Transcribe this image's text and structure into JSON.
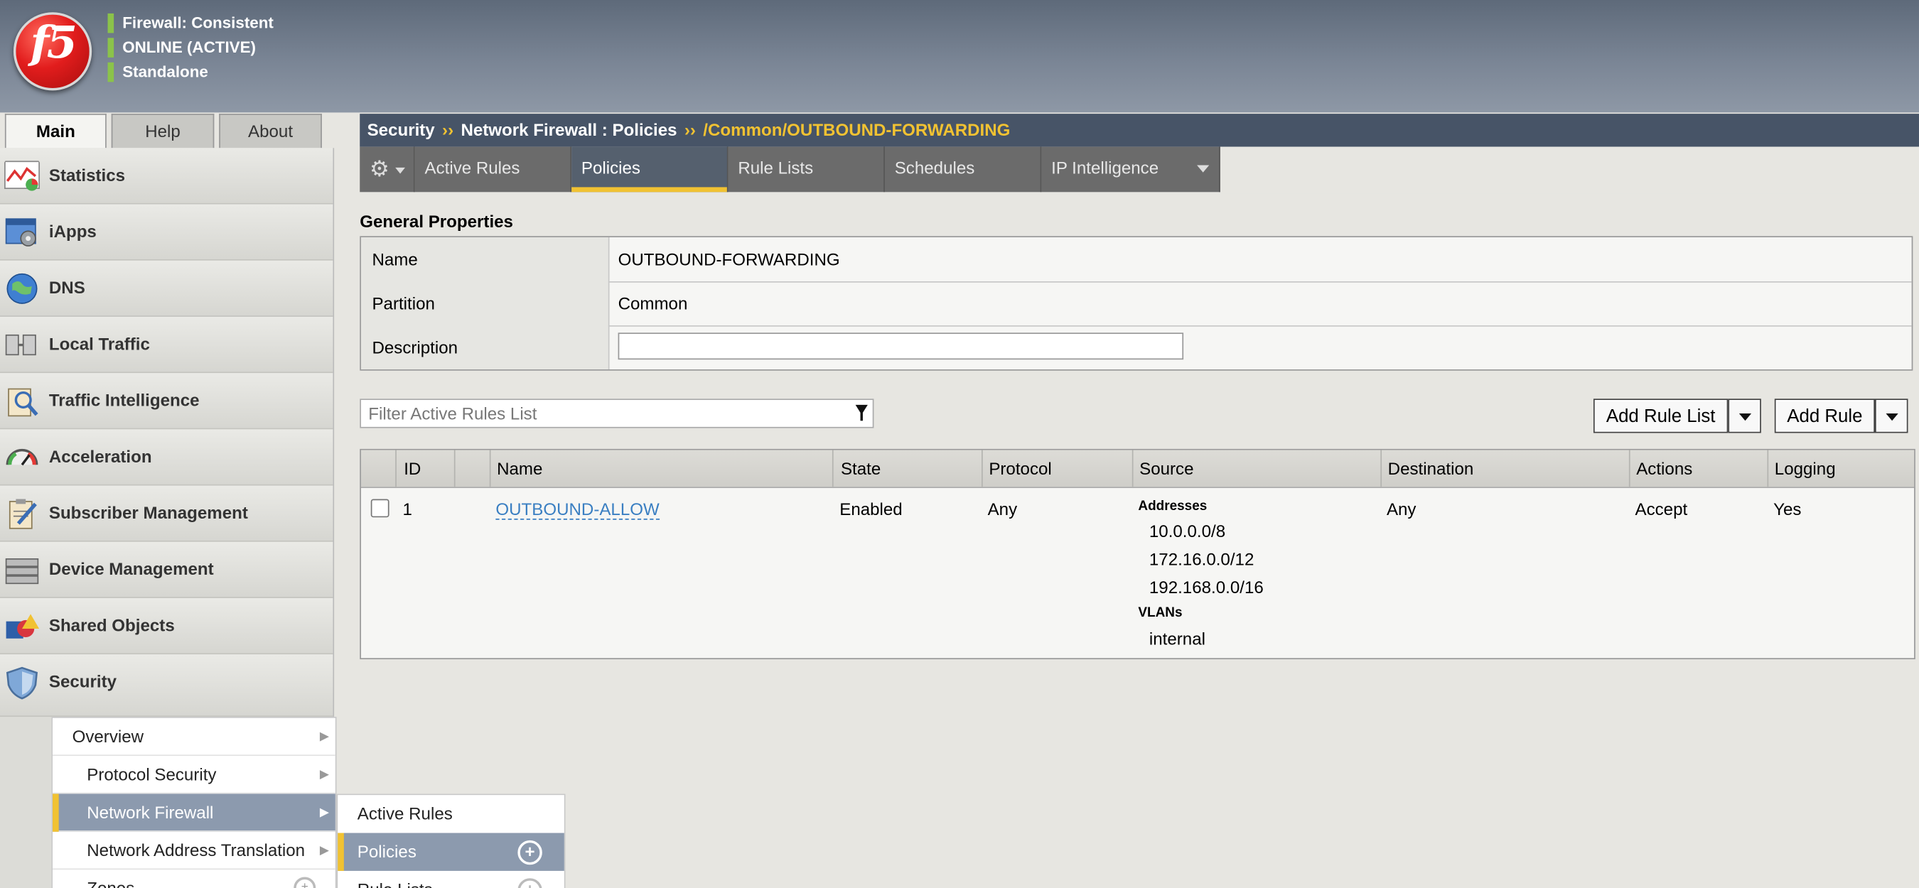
{
  "header": {
    "logo_text": "f5",
    "status": [
      "Firewall: Consistent",
      "ONLINE (ACTIVE)",
      "Standalone"
    ]
  },
  "left_tabs": [
    "Main",
    "Help",
    "About"
  ],
  "nav": [
    {
      "label": "Statistics",
      "icon": "chart-icon"
    },
    {
      "label": "iApps",
      "icon": "iapps-icon"
    },
    {
      "label": "DNS",
      "icon": "globe-icon"
    },
    {
      "label": "Local Traffic",
      "icon": "local-traffic-icon"
    },
    {
      "label": "Traffic Intelligence",
      "icon": "traffic-intelligence-icon"
    },
    {
      "label": "Acceleration",
      "icon": "speedometer-icon"
    },
    {
      "label": "Subscriber Management",
      "icon": "clipboard-icon"
    },
    {
      "label": "Device Management",
      "icon": "server-icon"
    },
    {
      "label": "Shared Objects",
      "icon": "shapes-icon"
    },
    {
      "label": "Security",
      "icon": "shield-icon"
    }
  ],
  "security_submenu": [
    "Overview",
    "Protocol Security",
    "Network Firewall",
    "Network Address Translation",
    "Zones"
  ],
  "flyout": [
    "Active Rules",
    "Policies",
    "Rule Lists"
  ],
  "breadcrumb": {
    "a": "Security",
    "b": "Network Firewall : Policies",
    "current": "/Common/OUTBOUND-FORWARDING",
    "sep": "››"
  },
  "tabs": [
    "Active Rules",
    "Policies",
    "Rule Lists",
    "Schedules",
    "IP Intelligence"
  ],
  "general": {
    "title": "General Properties",
    "rows": [
      {
        "k": "Name",
        "v": "OUTBOUND-FORWARDING"
      },
      {
        "k": "Partition",
        "v": "Common"
      },
      {
        "k": "Description",
        "v": ""
      }
    ]
  },
  "filter": {
    "placeholder": "Filter Active Rules List"
  },
  "buttons": {
    "add_rule_list": "Add Rule List",
    "add_rule": "Add Rule"
  },
  "table": {
    "headers": [
      "ID",
      "Name",
      "State",
      "Protocol",
      "Source",
      "Destination",
      "Actions",
      "Logging"
    ],
    "row": {
      "id": "1",
      "name": "OUTBOUND-ALLOW",
      "state": "Enabled",
      "protocol": "Any",
      "source_addresses_label": "Addresses",
      "source_addresses": [
        "10.0.0.0/8",
        "172.16.0.0/12",
        "192.168.0.0/16"
      ],
      "source_vlans_label": "VLANs",
      "source_vlans": [
        "internal"
      ],
      "destination": "Any",
      "action": "Accept",
      "logging": "Yes"
    }
  }
}
